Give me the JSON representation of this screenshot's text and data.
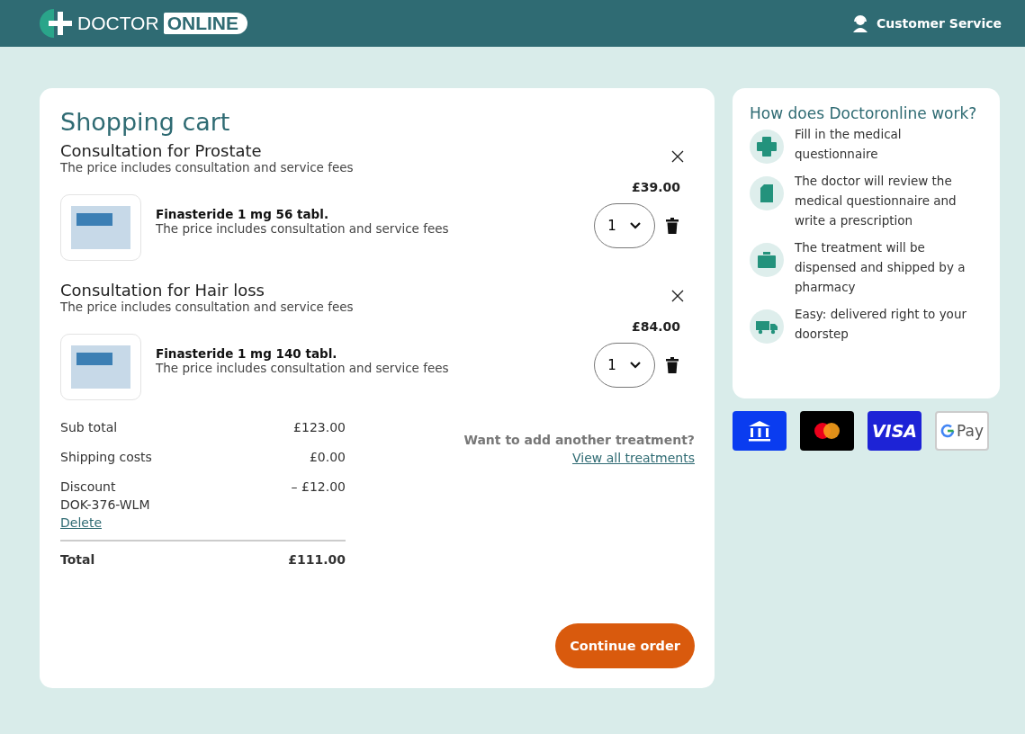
{
  "header": {
    "logo": {
      "word_1": "DOCTOR",
      "word_2": "ONLINE"
    },
    "service_link": "Customer Service"
  },
  "cart": {
    "title": "Shopping cart",
    "consultations": [
      {
        "title": "Consultation for Prostate",
        "subtitle": "The price includes consultation and service fees",
        "product": {
          "name": "Finasteride 1 mg 56 tabl.",
          "description": "The price includes consultation and service fees",
          "price": "£39.00",
          "quantity": "1"
        }
      },
      {
        "title": "Consultation for Hair loss",
        "subtitle": "The price includes consultation and service fees",
        "product": {
          "name": "Finasteride 1 mg 140 tabl.",
          "description": "The price includes consultation and service fees",
          "price": "£84.00",
          "quantity": "1"
        }
      }
    ],
    "summary": {
      "rows": [
        {
          "label": "Sub total",
          "value": "£123.00"
        },
        {
          "label": "Shipping costs",
          "value": "£0.00"
        },
        {
          "label": "Discount",
          "value": "– £12.00",
          "code": "DOK-376-WLM",
          "action": "Delete"
        }
      ],
      "total_label": "Total",
      "total_value": "£111.00"
    },
    "add_more": {
      "question": "Want to add another treatment?",
      "link": "View all treatments"
    },
    "continue_button": "Continue order"
  },
  "how_it_works": {
    "title": "How does Doctoronline work?",
    "steps": [
      {
        "kind": "cross",
        "text": "Fill in the medical questionnaire"
      },
      {
        "kind": "document",
        "text": "The doctor will review the medical questionnaire and write a prescription"
      },
      {
        "kind": "case",
        "text": "The treatment will be dispensed and shipped by a pharmacy"
      },
      {
        "kind": "truck",
        "text": "Easy: delivered right to your doorstep"
      }
    ]
  },
  "payment_methods": [
    {
      "kind": "bank"
    },
    {
      "kind": "mastercard"
    },
    {
      "kind": "visa",
      "label": "VISA"
    },
    {
      "kind": "gpay",
      "label": "Pay"
    }
  ]
}
